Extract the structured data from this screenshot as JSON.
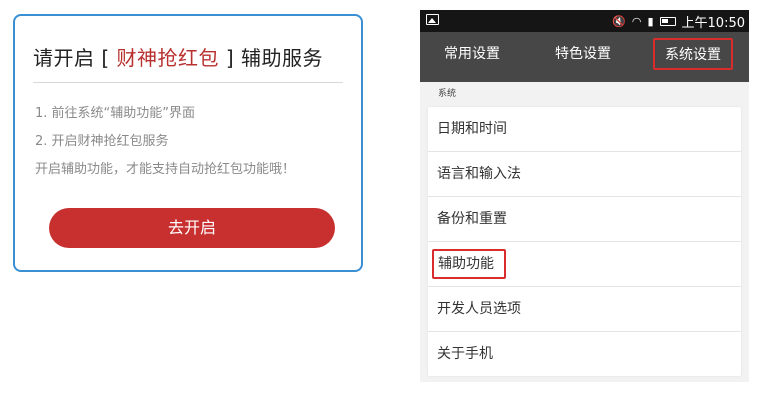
{
  "dialog": {
    "title_prefix": "请开启 [ ",
    "title_highlight": "财神抢红包",
    "title_suffix": " ] 辅助服务",
    "steps": [
      "1. 前往系统“辅助功能”界面",
      "2. 开启财神抢红包服务",
      "开启辅助功能，才能支持自动抢红包功能哦！"
    ],
    "open_button": "去开启"
  },
  "phone": {
    "status_bar": {
      "time": "上午10:50",
      "icons": [
        "image-icon",
        "mute-icon",
        "wifi-icon",
        "signal-icon",
        "battery-icon"
      ]
    },
    "tabs": [
      "常用设置",
      "特色设置",
      "系统设置"
    ],
    "active_tab_highlighted": "系统设置",
    "section_label": "系统",
    "items": [
      "日期和时间",
      "语言和输入法",
      "备份和重置",
      "辅助功能",
      "开发人员选项",
      "关于手机"
    ],
    "highlighted_item": "辅助功能"
  },
  "colors": {
    "dialog_border": "#3b8fd3",
    "accent_red": "#c8302f",
    "highlight_box": "#d92c2c",
    "tab_bar": "#474747",
    "status_bar": "#151515"
  }
}
